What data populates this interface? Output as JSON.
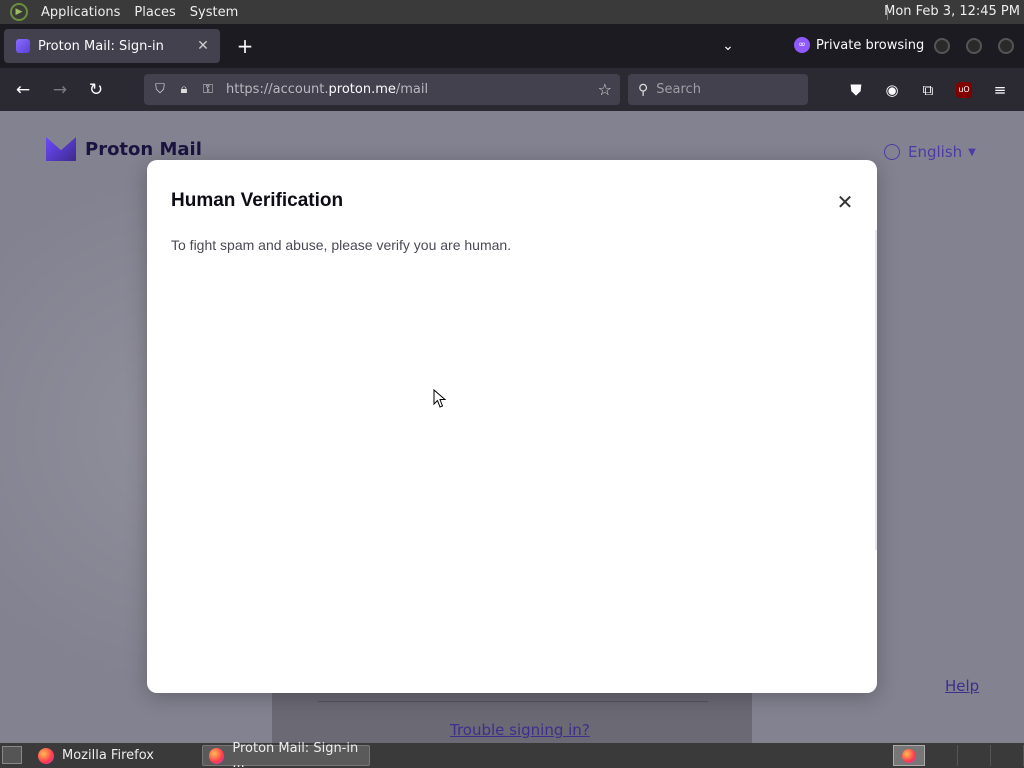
{
  "top_panel": {
    "menus": [
      "Applications",
      "Places",
      "System"
    ],
    "clock": "Mon Feb  3, 12:45 PM"
  },
  "browser": {
    "tab": {
      "title": "Proton Mail: Sign-in"
    },
    "private_label": "Private browsing",
    "url": {
      "prefix": "https://account.",
      "domain": "proton.me",
      "path": "/mail"
    },
    "search_placeholder": "Search",
    "extension_badge": "uO"
  },
  "page": {
    "brand": "Proton Mail",
    "language": "English",
    "trouble_link": "Trouble signing in?",
    "help_link": "Help"
  },
  "modal": {
    "title": "Human Verification",
    "description": "To fight spam and abuse, please verify you are human."
  },
  "taskbar": {
    "tasks": [
      "Mozilla Firefox",
      "Proton Mail: Sign-in ..."
    ]
  },
  "colors": {
    "accent": "#6d4aff",
    "private": "#9059ff"
  }
}
